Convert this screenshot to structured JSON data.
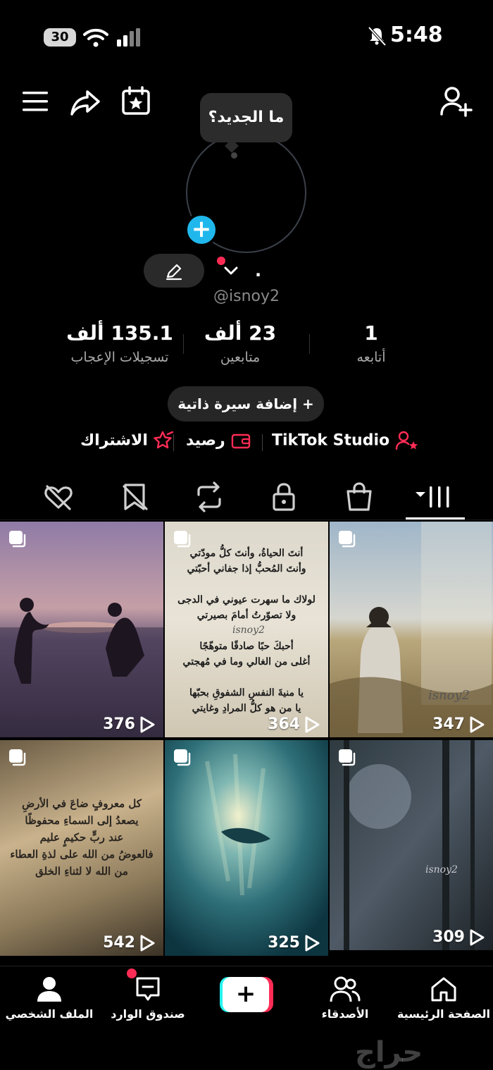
{
  "status_bar": {
    "battery": "30",
    "time": "5:48"
  },
  "profile": {
    "whats_new": "ما الجديد؟",
    "display_name": ".",
    "handle": "@isnoy2",
    "stats": [
      {
        "value": "135.1 ألف",
        "label": "تسجيلات الإعجاب"
      },
      {
        "value": "23 ألف",
        "label": "متابعين"
      },
      {
        "value": "1",
        "label": "أتابعه"
      }
    ],
    "add_bio": "+ إضافة سيرة ذاتية",
    "links": {
      "subscription": "الاشتراك",
      "balance": "رصيد",
      "studio": "TikTok Studio"
    }
  },
  "videos": [
    {
      "views": "376",
      "caption": ""
    },
    {
      "views": "364",
      "caption": "أنتَ الحياةُ، وأنتَ كلُّ مودّتي\nوأنتَ المُحبُّ إذا جفاني أحبّتي\n\nلولاك ما سهرت عيوني في الدجى\nولا تصوّرتُ أمامَ بصيرتي\n\nأحبكَ حبًا صادقًا متوهّجًا\nأغلى من الغالي وما في مُهجتي\n\nيا منيةَ النفسِ الشفوقِ بحبّها\nيا من هو كلُّ المرادِ وغايتي"
    },
    {
      "views": "347",
      "caption": ""
    },
    {
      "views": "542",
      "caption": "كل معروفٍ ضاعَ في الأرضِ\nيصعدُ إلى السماءِ محفوظًا\nعند ربٍّ حكيمٍ عليم\nفالعوضُ من الله على لذةِ العطاء\nمن الله لا لثناءِ الخلق"
    },
    {
      "views": "325",
      "caption": ""
    },
    {
      "views": "309",
      "caption": ""
    }
  ],
  "watermarks": [
    "isnoy2",
    "isnoy2",
    "isnoy2"
  ],
  "nav": {
    "profile": "الملف الشخصي",
    "inbox": "صندوق الوارد",
    "create": "+",
    "friends": "الأصدقاء",
    "home": "الصفحة الرئيسية"
  },
  "watermark_site": "حراج"
}
